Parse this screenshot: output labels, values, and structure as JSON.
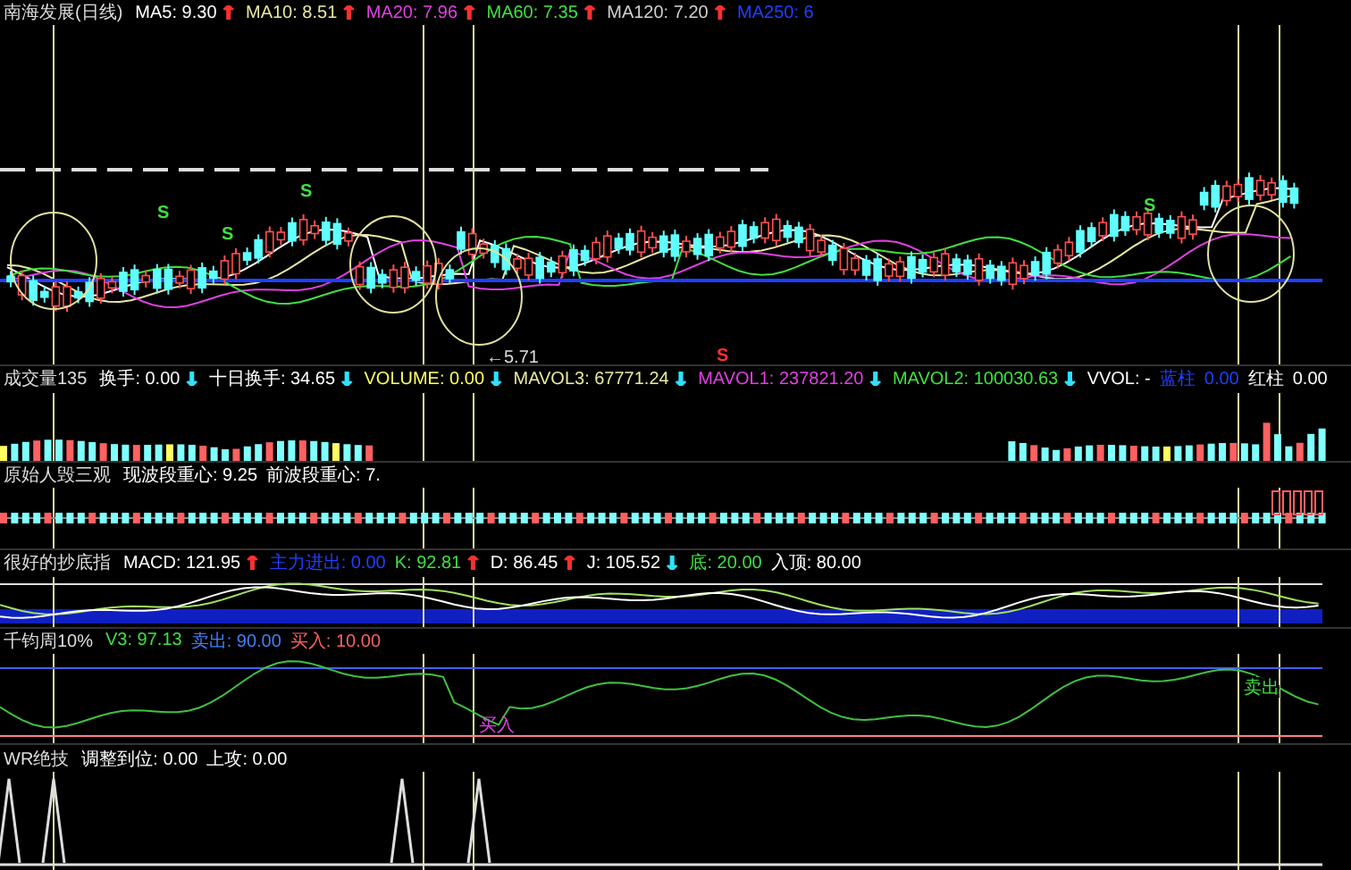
{
  "header": {
    "title": "南海发展(日线)",
    "indicators": [
      {
        "text": "MA5: 9.30",
        "color": "#ffffff",
        "arrow": {
          "text": "↑",
          "color": "#ff3030"
        }
      },
      {
        "text": "MA10: 8.51",
        "color": "#e8e8a0",
        "arrow": {
          "text": "↑",
          "color": "#ff3030"
        }
      },
      {
        "text": "MA20: 7.96",
        "color": "#e040e0",
        "arrow": {
          "text": "↑",
          "color": "#ff3030"
        }
      },
      {
        "text": "MA60: 7.35",
        "color": "#40e040",
        "arrow": {
          "text": "↑",
          "color": "#ff3030"
        }
      },
      {
        "text": "MA120: 7.20",
        "color": "#d0d0d0",
        "arrow": {
          "text": "↑",
          "color": "#ff3030"
        }
      },
      {
        "text": "MA250: 6",
        "color": "#2040ff"
      }
    ]
  },
  "main_chart": {
    "markers": [
      "S",
      "S",
      "S",
      "S"
    ],
    "sell_marker": "S",
    "price_note": "←5.71"
  },
  "panels": [
    {
      "kind": "volume",
      "title": "成交量135",
      "indicators": [
        {
          "text": "换手: 0.00",
          "color": "#ffffff",
          "arrow": {
            "text": "↓",
            "color": "#30e0ff"
          }
        },
        {
          "text": "十日换手: 34.65",
          "color": "#ffffff",
          "arrow": {
            "text": "↓",
            "color": "#30e0ff"
          }
        },
        {
          "text": "VOLUME: 0.00",
          "color": "#ffff60",
          "arrow": {
            "text": "↓",
            "color": "#30e0ff"
          }
        },
        {
          "text": "MAVOL3: 67771.24",
          "color": "#e8e8a0",
          "arrow": {
            "text": "↓",
            "color": "#30e0ff"
          }
        },
        {
          "text": "MAVOL1: 237821.20",
          "color": "#e040e0",
          "arrow": {
            "text": "↓",
            "color": "#30e0ff"
          }
        },
        {
          "text": "MAVOL2: 100030.63",
          "color": "#40e040",
          "arrow": {
            "text": "↓",
            "color": "#30e0ff"
          }
        },
        {
          "text": "VVOL: -",
          "color": "#ffffff"
        },
        {
          "text": "蓝柱",
          "color": "#2040ff"
        },
        {
          "text": "0.00",
          "color": "#2040ff"
        },
        {
          "text": "红柱",
          "color": "#ffffff"
        },
        {
          "text": "0.00",
          "color": "#ffffff"
        }
      ]
    },
    {
      "kind": "bars",
      "title": "原始人毁三观",
      "indicators": [
        {
          "text": "现波段重心: 9.25",
          "color": "#ffffff"
        },
        {
          "text": "前波段重心: 7.",
          "color": "#ffffff"
        }
      ]
    },
    {
      "kind": "oscillator",
      "title": "很好的抄底指",
      "indicators": [
        {
          "text": "MACD: 121.95",
          "color": "#ffffff",
          "arrow": {
            "text": "↑",
            "color": "#ff3030"
          }
        },
        {
          "text": "主力进出: 0.00",
          "color": "#2040ff"
        },
        {
          "text": "K: 92.81",
          "color": "#40e040",
          "arrow": {
            "text": "↑",
            "color": "#ff3030"
          }
        },
        {
          "text": "D: 86.45",
          "color": "#ffffff",
          "arrow": {
            "text": "↑",
            "color": "#ff3030"
          }
        },
        {
          "text": "J: 105.52",
          "color": "#ffffff",
          "arrow": {
            "text": "↓",
            "color": "#30e0ff"
          }
        },
        {
          "text": "底: 20.00",
          "color": "#40e040"
        },
        {
          "text": "入顶: 80.00",
          "color": "#ffffff"
        }
      ]
    },
    {
      "kind": "line",
      "title": "千钧周10%",
      "indicators": [
        {
          "text": "V3: 97.13",
          "color": "#40e040"
        },
        {
          "text": "卖出: 90.00",
          "color": "#4080ff"
        },
        {
          "text": "买入: 10.00",
          "color": "#ff6060"
        }
      ],
      "labels": [
        {
          "text": "买入",
          "color": "#e040e0"
        },
        {
          "text": "卖出",
          "color": "#40e040"
        }
      ]
    },
    {
      "kind": "spikes",
      "title": "WR绝技",
      "indicators": [
        {
          "text": "调整到位: 0.00",
          "color": "#ffffff"
        },
        {
          "text": "上攻: 0.00",
          "color": "#ffffff"
        }
      ]
    }
  ]
}
